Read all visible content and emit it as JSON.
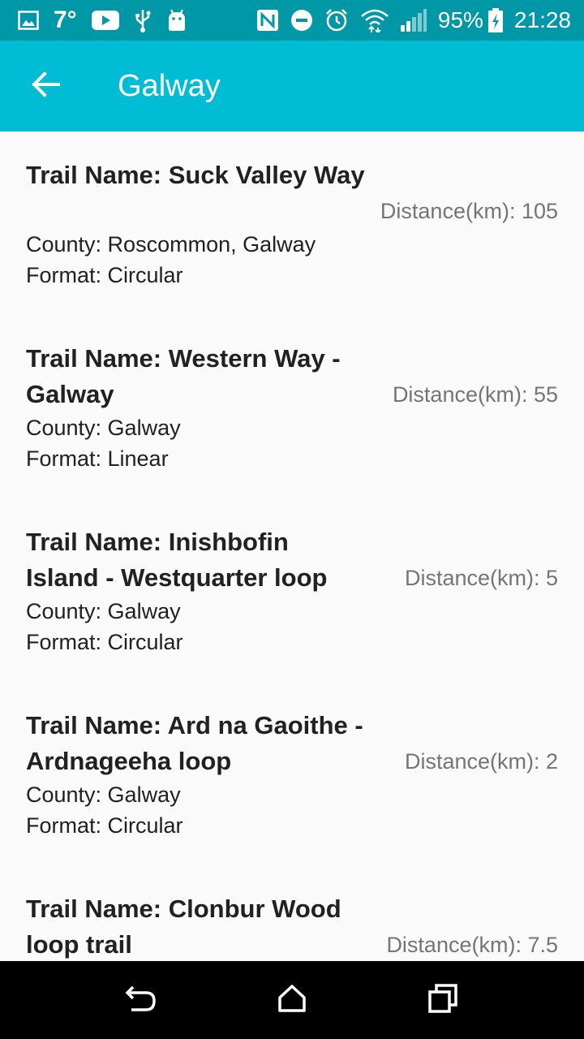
{
  "status_bar": {
    "temperature": "7°",
    "battery": "95%",
    "time": "21:28",
    "icons_left": [
      "image-icon",
      "temperature",
      "youtube-icon",
      "usb-icon",
      "android-icon"
    ],
    "icons_right": [
      "nfc-icon",
      "do-not-disturb-icon",
      "alarm-icon",
      "wifi-icon",
      "signal-icon",
      "battery-charging-icon"
    ]
  },
  "app_bar": {
    "title": "Galway",
    "back_icon": "arrow-back-icon",
    "color": "#00bcd4",
    "status_color": "#0097a7"
  },
  "trails": [
    {
      "name": "Trail Name: Suck Valley Way",
      "county": "County: Roscommon, Galway",
      "format": "Format: Circular",
      "distance": "Distance(km): 105"
    },
    {
      "name": "Trail Name: Western Way - Galway",
      "county": "County: Galway",
      "format": "Format: Linear",
      "distance": "Distance(km): 55"
    },
    {
      "name": "Trail Name: Inishbofin Island - Westquarter loop",
      "county": "County: Galway",
      "format": "Format: Circular",
      "distance": "Distance(km): 5"
    },
    {
      "name": "Trail Name: Ard na Gaoithe - Ardnageeha loop",
      "county": "County: Galway",
      "format": "Format: Circular",
      "distance": "Distance(km): 2"
    },
    {
      "name": "Trail Name: Clonbur Wood loop trail",
      "county": "",
      "format": "",
      "distance": "Distance(km): 7.5"
    }
  ],
  "nav_bar": {
    "back_icon": "nav-back-icon",
    "home_icon": "nav-home-icon",
    "recents_icon": "nav-recents-icon"
  }
}
